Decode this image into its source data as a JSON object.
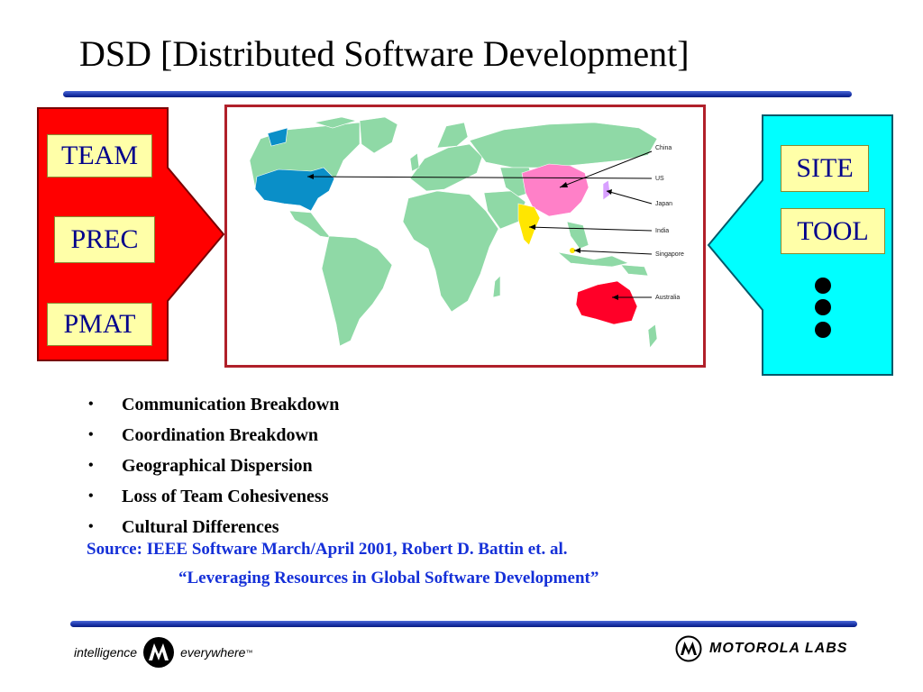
{
  "slide": {
    "title": "DSD [Distributed Software Development]",
    "left_panel": {
      "color": "#ff0000",
      "items": [
        "TEAM",
        "PREC",
        "PMAT"
      ]
    },
    "right_panel": {
      "color": "#00ffff",
      "items": [
        "SITE",
        "TOOL"
      ]
    },
    "map": {
      "labels": [
        "China",
        "US",
        "Japan",
        "India",
        "Singapore",
        "Australia"
      ],
      "land_color": "#8fd9a6",
      "highlights": {
        "US": "#0a8fc8",
        "China": "#ff80c8",
        "India": "#ffe600",
        "Australia": "#ff0028"
      }
    },
    "bullets": [
      "Communication Breakdown",
      "Coordination Breakdown",
      "Geographical Dispersion",
      "Loss of Team Cohesiveness",
      "Cultural Differences"
    ],
    "source_line1": "Source: IEEE Software March/April 2001, Robert D. Battin et. al.",
    "source_line2": "“Leveraging Resources in Global Software Development”",
    "footer": {
      "left_text_1": "intelligence",
      "left_text_2": "everywhere",
      "left_tm": "™",
      "right_text": "MOTOROLA LABS",
      "logo_icon": "motorola-batwing-logo"
    }
  }
}
